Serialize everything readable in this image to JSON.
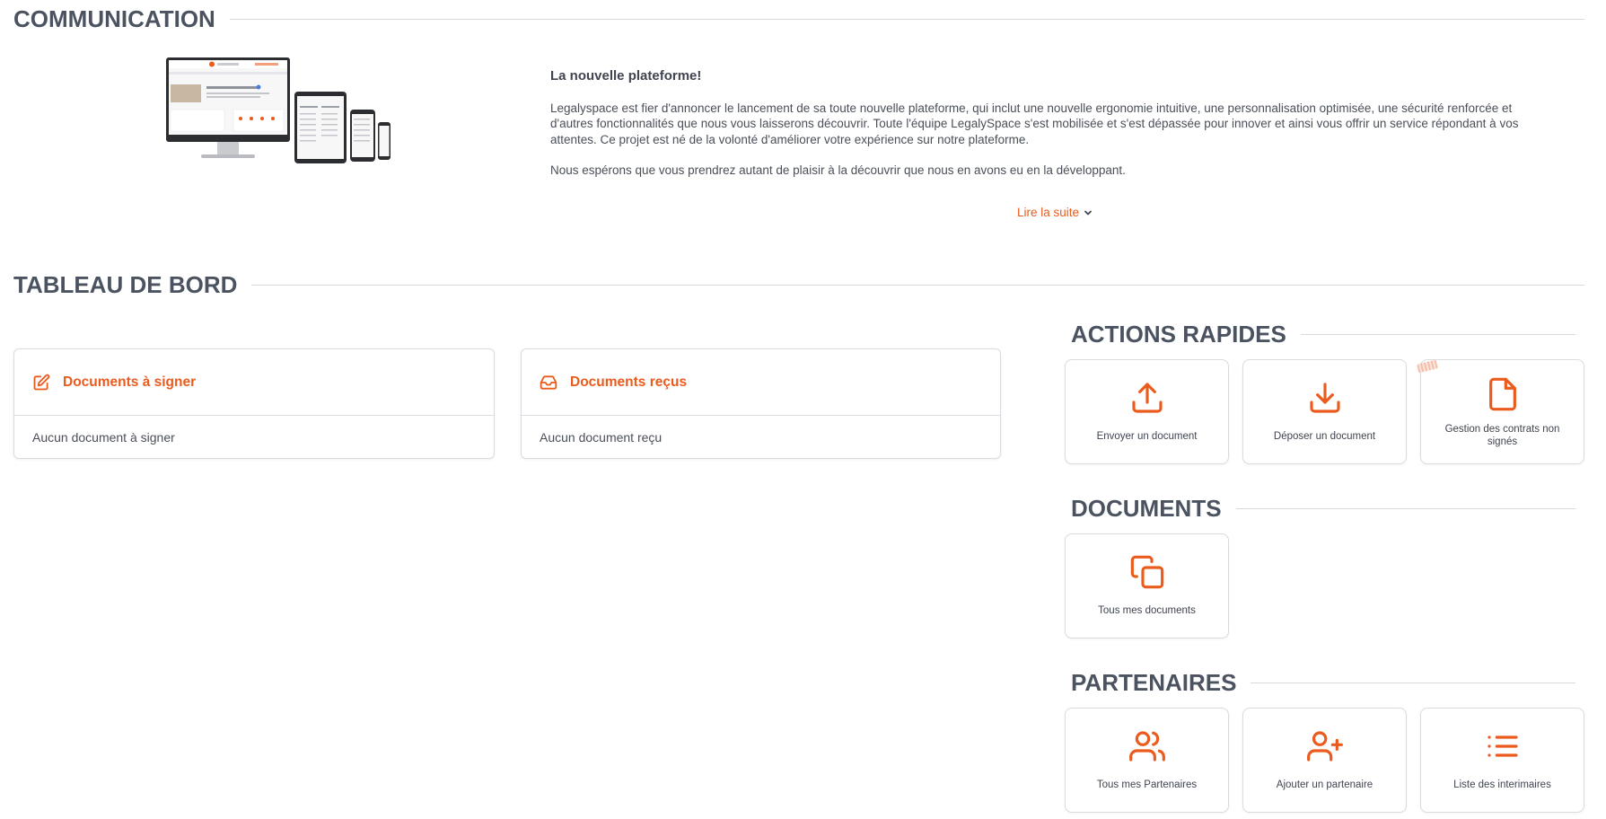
{
  "communication": {
    "heading": "COMMUNICATION",
    "article_title": "La nouvelle plateforme!",
    "paragraph1": "Legalyspace est fier d'annoncer le lancement de sa toute nouvelle plateforme, qui inclut une nouvelle ergonomie intuitive, une personnalisation optimisée, une sécurité renforcée et d'autres fonctionnalités que nous vous laisserons découvrir. Toute l'équipe LegalySpace s'est mobilisée et s'est dépassée pour innover et ainsi vous offrir un service répondant à vos attentes. Ce projet est né de la volonté d'améliorer votre expérience sur notre plateforme.",
    "paragraph2": "Nous espérons que vous prendrez autant de plaisir à la découvrir que nous en avons eu en la développant.",
    "read_more": "Lire la suite"
  },
  "dashboard": {
    "heading": "TABLEAU DE BORD",
    "cards": [
      {
        "title": "Documents à signer",
        "empty": "Aucun document à signer",
        "icon": "edit-icon"
      },
      {
        "title": "Documents reçus",
        "empty": "Aucun document reçu",
        "icon": "inbox-icon"
      }
    ]
  },
  "quick_actions": {
    "heading": "ACTIONS RAPIDES",
    "tiles": [
      {
        "label": "Envoyer un document",
        "icon": "upload-icon"
      },
      {
        "label": "Déposer un document",
        "icon": "download-icon"
      },
      {
        "label": "Gestion des contrats non signés",
        "icon": "file-icon"
      }
    ]
  },
  "documents": {
    "heading": "DOCUMENTS",
    "tiles": [
      {
        "label": "Tous mes documents",
        "icon": "copy-icon"
      }
    ]
  },
  "partners": {
    "heading": "PARTENAIRES",
    "tiles": [
      {
        "label": "Tous mes Partenaires",
        "icon": "users-icon"
      },
      {
        "label": "Ajouter un partenaire",
        "icon": "user-plus-icon"
      },
      {
        "label": "Liste des interimaires",
        "icon": "list-icon"
      }
    ]
  },
  "colors": {
    "accent": "#ea5b1d",
    "heading": "#4b5361",
    "border": "#d8dbe0"
  }
}
